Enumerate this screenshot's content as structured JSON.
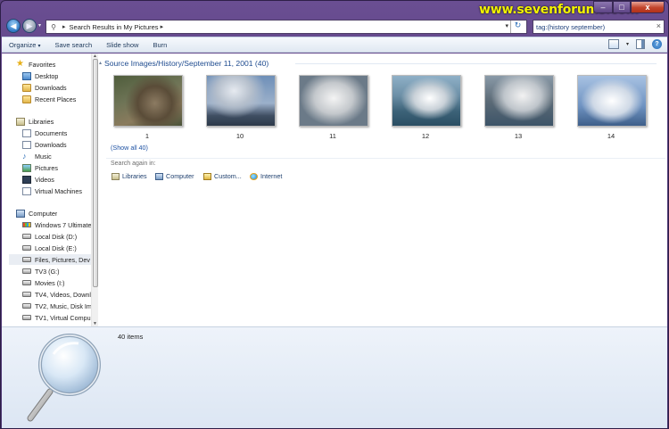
{
  "watermark": "www.sevenforums.com",
  "window": {
    "caption_min": "–",
    "caption_max": "□",
    "caption_close": "x"
  },
  "address_bar": {
    "path": [
      "Search Results in My Pictures"
    ],
    "separator": "▸",
    "refresh_label": "↻"
  },
  "search": {
    "value": "tag:(history september)",
    "clear": "×"
  },
  "toolbar": {
    "organize": "Organize",
    "organize_caret": "▾",
    "save_search": "Save search",
    "slide_show": "Slide show",
    "burn": "Burn"
  },
  "nav": {
    "favorites": {
      "label": "Favorites",
      "items": [
        "Desktop",
        "Downloads",
        "Recent Places"
      ]
    },
    "libraries": {
      "label": "Libraries",
      "items": [
        "Documents",
        "Downloads",
        "Music",
        "Pictures",
        "Videos",
        "Virtual Machines"
      ]
    },
    "computer": {
      "label": "Computer",
      "items": [
        "Windows 7 Ultimate",
        "Local Disk (D:)",
        "Local Disk (E:)",
        "Files, Pictures, Dev",
        "TV3 (G:)",
        "Movies (I:)",
        "TV4, Videos, Downl",
        "TV2, Music, Disk Im",
        "TV1, Virtual Compu"
      ]
    }
  },
  "results": {
    "group_title": "Source Images/History/September 11, 2001 (40)",
    "thumbnails": [
      {
        "label": "1"
      },
      {
        "label": "10"
      },
      {
        "label": "11"
      },
      {
        "label": "12"
      },
      {
        "label": "13"
      },
      {
        "label": "14"
      }
    ],
    "show_all": "(Show all 40)",
    "search_again_label": "Search again in:",
    "search_again": [
      "Libraries",
      "Computer",
      "Custom...",
      "Internet"
    ]
  },
  "details": {
    "count": "40 items"
  }
}
